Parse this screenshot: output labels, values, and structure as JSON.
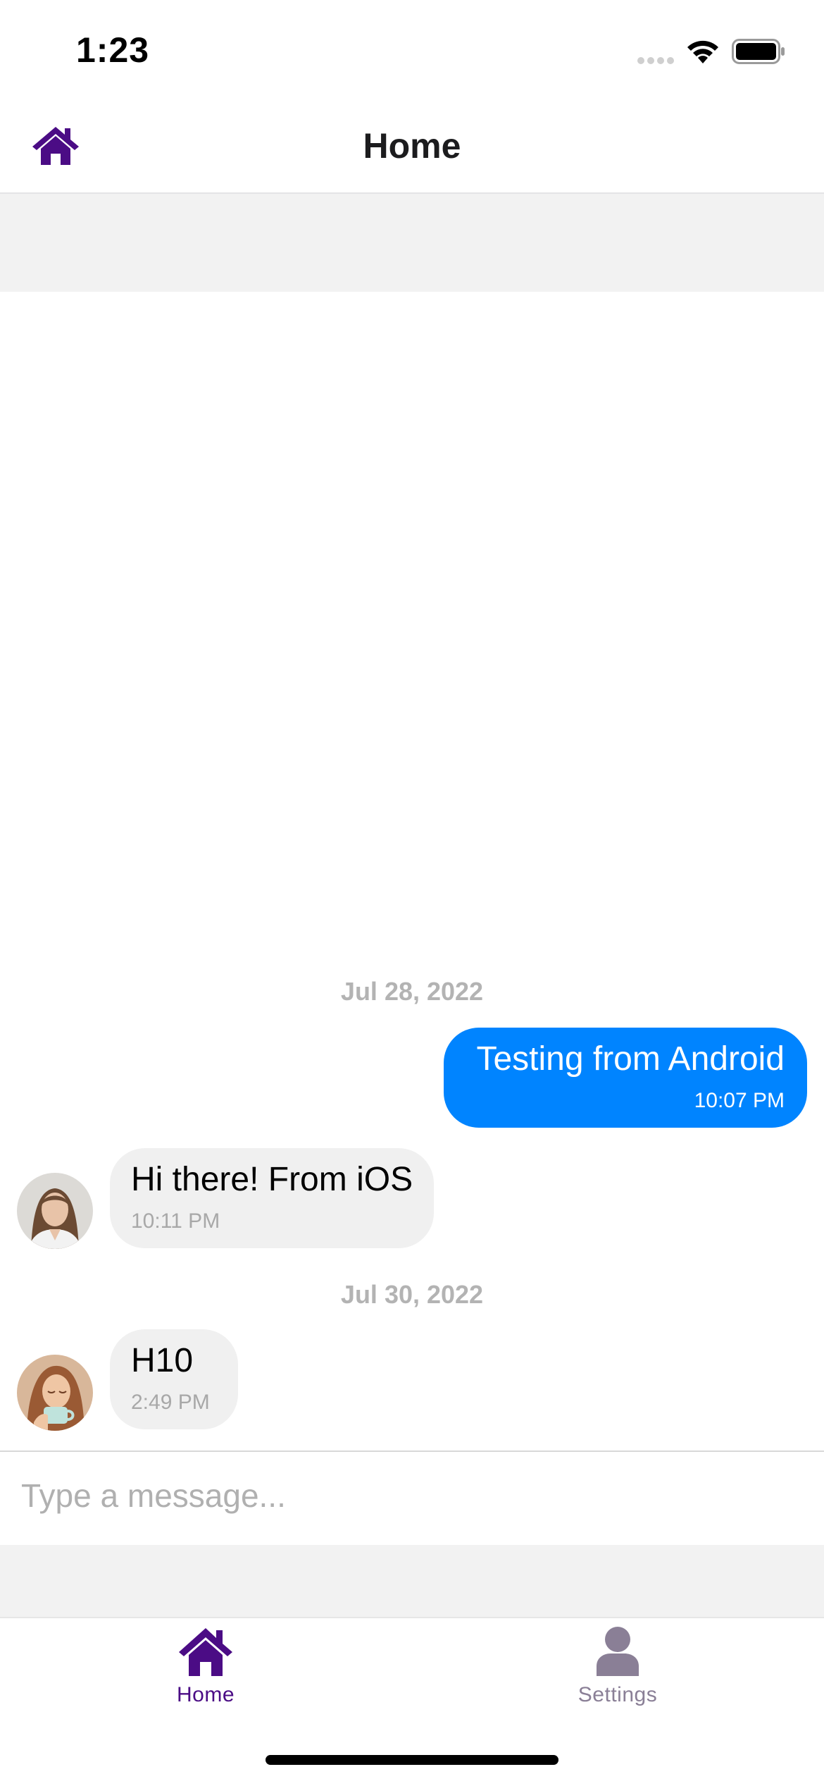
{
  "status_bar": {
    "time": "1:23"
  },
  "header": {
    "title": "Home",
    "icon": "home-icon"
  },
  "chat": {
    "groups": [
      {
        "date": "Jul 28, 2022",
        "messages": [
          {
            "direction": "outgoing",
            "text": "Testing from Android",
            "time": "10:07 PM"
          },
          {
            "direction": "incoming",
            "text": "Hi there! From iOS",
            "time": "10:11 PM",
            "avatar": "avatar-woman-portrait"
          }
        ]
      },
      {
        "date": "Jul 30, 2022",
        "messages": [
          {
            "direction": "incoming",
            "text": "H10",
            "time": "2:49 PM",
            "avatar": "avatar-woman-with-cup"
          }
        ]
      }
    ]
  },
  "composer": {
    "placeholder": "Type a message..."
  },
  "tab_bar": {
    "tabs": [
      {
        "label": "Home",
        "icon": "home-icon",
        "active": true
      },
      {
        "label": "Settings",
        "icon": "person-icon",
        "active": false
      }
    ]
  },
  "colors": {
    "brand_purple": "#4b0c85",
    "outgoing_bubble": "#0084ff",
    "incoming_bubble": "#f0f0f0",
    "inactive_tab": "#8a7f96"
  }
}
